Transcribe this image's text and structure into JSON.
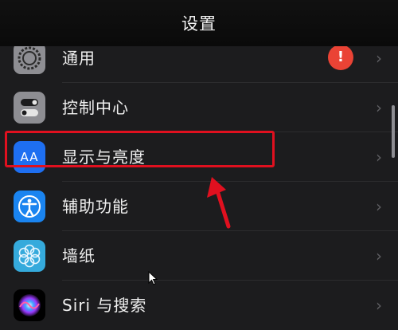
{
  "nav": {
    "title": "设置"
  },
  "rows": [
    {
      "label": "通用",
      "icon": "gear-icon",
      "badge": "!"
    },
    {
      "label": "控制中心",
      "icon": "control-center-icon"
    },
    {
      "label": "显示与亮度",
      "icon": "display-brightness-icon",
      "icon_text": "AA"
    },
    {
      "label": "辅助功能",
      "icon": "accessibility-icon"
    },
    {
      "label": "墙纸",
      "icon": "wallpaper-icon"
    },
    {
      "label": "Siri 与搜索",
      "icon": "siri-icon"
    }
  ],
  "chevron": "›",
  "colors": {
    "row_bg": "#1c1c1e",
    "highlight": "#e0101f",
    "badge": "#ea4335",
    "display_icon": "#1e6ff1",
    "accessibility_icon": "#1a84f0",
    "wallpaper_icon": "#35aadc",
    "control_center_icon": "#8e8e93"
  }
}
